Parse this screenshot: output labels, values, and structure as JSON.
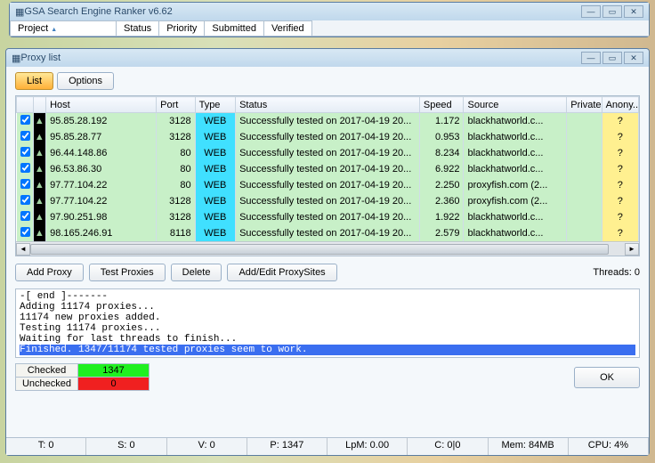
{
  "parent": {
    "title": "GSA Search Engine Ranker v6.62",
    "tabs": [
      "Project",
      "Status",
      "Priority",
      "Submitted",
      "Verified"
    ]
  },
  "proxy": {
    "title": "Proxy list",
    "toolbar": {
      "list": "List",
      "options": "Options"
    },
    "columns": {
      "host": "Host",
      "port": "Port",
      "type": "Type",
      "status": "Status",
      "speed": "Speed",
      "source": "Source",
      "private": "Private",
      "anony": "Anony..."
    },
    "rows": [
      {
        "host": "95.85.28.192",
        "port": "3128",
        "type": "WEB",
        "status": "Successfully tested on 2017-04-19 20...",
        "speed": "1.172",
        "source": "blackhatworld.c...",
        "anon": "?"
      },
      {
        "host": "95.85.28.77",
        "port": "3128",
        "type": "WEB",
        "status": "Successfully tested on 2017-04-19 20...",
        "speed": "0.953",
        "source": "blackhatworld.c...",
        "anon": "?"
      },
      {
        "host": "96.44.148.86",
        "port": "80",
        "type": "WEB",
        "status": "Successfully tested on 2017-04-19 20...",
        "speed": "8.234",
        "source": "blackhatworld.c...",
        "anon": "?"
      },
      {
        "host": "96.53.86.30",
        "port": "80",
        "type": "WEB",
        "status": "Successfully tested on 2017-04-19 20...",
        "speed": "6.922",
        "source": "blackhatworld.c...",
        "anon": "?"
      },
      {
        "host": "97.77.104.22",
        "port": "80",
        "type": "WEB",
        "status": "Successfully tested on 2017-04-19 20...",
        "speed": "2.250",
        "source": "proxyfish.com (2...",
        "anon": "?"
      },
      {
        "host": "97.77.104.22",
        "port": "3128",
        "type": "WEB",
        "status": "Successfully tested on 2017-04-19 20...",
        "speed": "2.360",
        "source": "proxyfish.com (2...",
        "anon": "?"
      },
      {
        "host": "97.90.251.98",
        "port": "3128",
        "type": "WEB",
        "status": "Successfully tested on 2017-04-19 20...",
        "speed": "1.922",
        "source": "blackhatworld.c...",
        "anon": "?"
      },
      {
        "host": "98.165.246.91",
        "port": "8118",
        "type": "WEB",
        "status": "Successfully tested on 2017-04-19 20...",
        "speed": "2.579",
        "source": "blackhatworld.c...",
        "anon": "?"
      }
    ],
    "actions": {
      "add": "Add Proxy",
      "test": "Test Proxies",
      "delete": "Delete",
      "sites": "Add/Edit ProxySites",
      "threads": "Threads: 0"
    },
    "log": {
      "l1": "-[ end ]-------",
      "l2": "Adding 11174 proxies...",
      "l3": "11174 new proxies added.",
      "l4": "Testing 11174 proxies...",
      "l5": "Waiting for last threads to finish...",
      "l6": "Finished. 1347/11174 tested proxies seem to work."
    },
    "counters": {
      "checked_label": "Checked",
      "checked_val": "1347",
      "unchecked_label": "Unchecked",
      "unchecked_val": "0"
    },
    "ok": "OK",
    "status": {
      "t": "T: 0",
      "s": "S: 0",
      "v": "V: 0",
      "p": "P: 1347",
      "lpm": "LpM: 0.00",
      "c": "C: 0|0",
      "mem": "Mem: 84MB",
      "cpu": "CPU: 4%"
    }
  }
}
